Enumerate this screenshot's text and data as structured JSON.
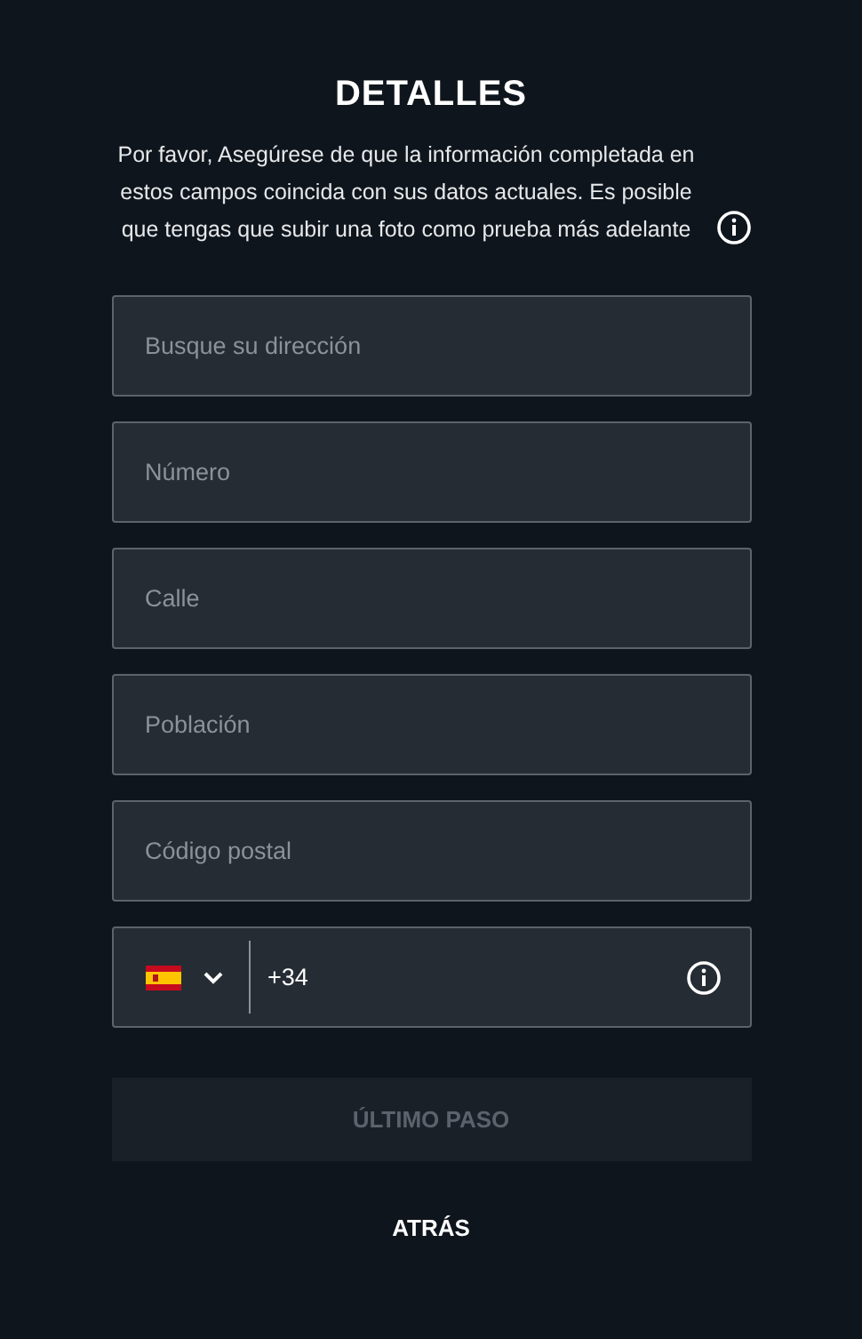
{
  "title": "DETALLES",
  "description": "Por favor, Asegúrese de que la información completada en estos campos coincida con sus datos actuales. Es posible que tengas que subir una foto como prueba más adelante",
  "fields": [
    {
      "placeholder": "Busque su dirección"
    },
    {
      "placeholder": "Número"
    },
    {
      "placeholder": "Calle"
    },
    {
      "placeholder": "Población"
    },
    {
      "placeholder": "Código postal"
    }
  ],
  "phone": {
    "value": "+34"
  },
  "submit": {
    "label": "ÚLTIMO PASO",
    "disabled": true
  },
  "back": {
    "label": "ATRÁS"
  }
}
